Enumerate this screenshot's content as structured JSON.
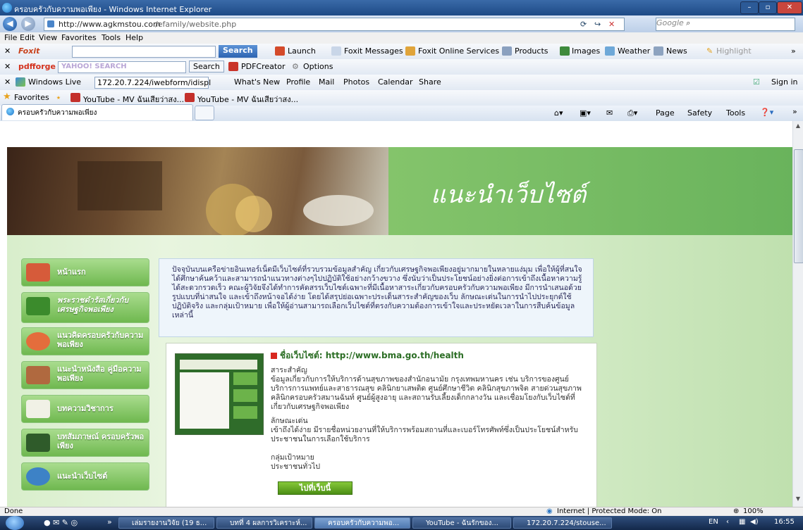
{
  "window": {
    "title": "ครอบครัวกับความพอเพียง - Windows Internet Explorer",
    "buttons": [
      "–",
      "▫",
      "✕"
    ]
  },
  "address": {
    "url_host": "http://www.agkmstou.com",
    "url_path": "/efamily/website.php",
    "search_placeholder": "Google"
  },
  "menu": [
    "File",
    "Edit",
    "View",
    "Favorites",
    "Tools",
    "Help"
  ],
  "foxit_bar": {
    "brand": "Foxit",
    "search": "Search",
    "launch": "Launch",
    "messages": "Foxit Messages",
    "online": "Foxit Online Services",
    "products": "Products",
    "images": "Images",
    "weather": "Weather",
    "news": "News",
    "highlight": "Highlight"
  },
  "pdf_bar": {
    "brand": "pdfforge",
    "yahoo": "YAHOO! SEARCH",
    "search": "Search",
    "pdfcreator": "PDFCreator",
    "options": "Options"
  },
  "live_bar": {
    "brand": "Windows Live",
    "field": "172.20.7.224/iwebform/idispl",
    "links": [
      "What's New",
      "Profile",
      "Mail",
      "Photos",
      "Calendar",
      "Share"
    ],
    "signin": "Sign in"
  },
  "favorites_bar": {
    "label": "Favorites",
    "items": [
      "YouTube - MV ฉันเสียว่าสง...",
      "YouTube - MV ฉันเสียว่าสง..."
    ]
  },
  "tab": {
    "label": "ครอบครัวกับความพอเพียง"
  },
  "command_bar": {
    "page": "Page",
    "safety": "Safety",
    "tools": "Tools"
  },
  "banner": {
    "title": "แนะนำเว็บไซต์"
  },
  "nav": [
    {
      "label": "หน้าแรก"
    },
    {
      "label": "พระราชดำรัสเกี่ยวกับเศรษฐกิจพอเพียง"
    },
    {
      "label": "แนวคิดครอบครัวกับความพอเพียง"
    },
    {
      "label": "แนะนำหนังสือ คู่มือความพอเพียง"
    },
    {
      "label": "บทความวิชาการ"
    },
    {
      "label": "บทสัมภาษณ์ ครอบครัวพอเพียง"
    },
    {
      "label": "แนะนำเว็บไซต์"
    }
  ],
  "intro": {
    "text": "ปัจจุบันบนเครือข่ายอินเทอร์เน็ตมีเว็บไซต์ที่รวบรวมข้อมูลสำคัญ เกี่ยวกับเศรษฐกิจพอเพียงอยู่มากมายในหลายแง่มุม เพื่อให้ผู้ที่สนใจได้ศึกษาค้นคว้าและสามารถนำแนวทางต่างๆไปปฏิบัติใช้อย่างกว้างขวาง ซึ่งนับว่าเป็นประโยชน์อย่างยิ่งต่อการเข้าถึงเนื้อหาความรู้ได้สะดวกรวดเร็ว คณะผู้วิจัยจึงได้ทำการคัดสรรเว็บไซต์เฉพาะที่มีเนื้อหาสาระเกี่ยวกับครอบครัวกับความพอเพียง มีการนำเสนอด้วยรูปแบบที่น่าสนใจ และเข้าถึงหน้าจอได้ง่าย โดยได้สรุปย่อเฉพาะประเด็นสาระสำคัญของเว็บ ลักษณะเด่นในการนำไปประยุกต์ใช้ปฏิบัติจริง และกลุ่มเป้าหมาย เพื่อให้ผู้อ่านสามารถเลือกเว็บไซต์ที่ตรงกับความต้องการเข้าใจและประหยัดเวลาในการสืบค้นข้อมูลเหล่านี้"
  },
  "card": {
    "heading": "ชื่อเว็บไซต์: http://www.bma.go.th/health",
    "s1_title": "สาระสำคัญ",
    "s1_text": "ข้อมูลเกี่ยวกับการให้บริการด้านสุขภาพของสำนักอนามัย กรุงเทพมหานคร เช่น บริการของศูนย์บริการการแพทย์และสาธารณสุข คลินิกยาเสพติด ศูนย์ศึกษาชีวิต คลินิกสุขภาพจิต สายด่วนสุขภาพ คลินิกครอบครัวสมานฉันท์ ศูนย์ผู้สูงอายุ และสถานรับเลี้ยงเด็กกลางวัน และเชื่อมโยงกับเว็บไซต์ที่เกี่ยวกับเศรษฐกิจพอเพียง",
    "s2_title": "ลักษณะเด่น",
    "s2_text": "เข้าถึงได้ง่าย มีรายชื่อหน่วยงานที่ให้บริการพร้อมสถานที่และเบอร์โทรศัพท์ซึ่งเป็นประโยชน์สำหรับประชาชนในการเลือกใช้บริการ",
    "s3_title": "กลุ่มเป้าหมาย",
    "s3_text": "ประชาชนทั่วไป",
    "go": "ไปที่เว็บนี้"
  },
  "status": {
    "left": "Done",
    "zone": "Internet | Protected Mode: On",
    "zoom": "100%"
  },
  "taskbar": {
    "items": [
      "เล่มรายงานวิจัย (19 ธ...",
      "บทที่ 4 ผลการวิเคราะห์...",
      "ครอบครัวกับความพอ...",
      "YouTube - ฉันรักของ...",
      "172.20.7.224/stouse..."
    ],
    "lang": "EN",
    "time": "16:55"
  }
}
